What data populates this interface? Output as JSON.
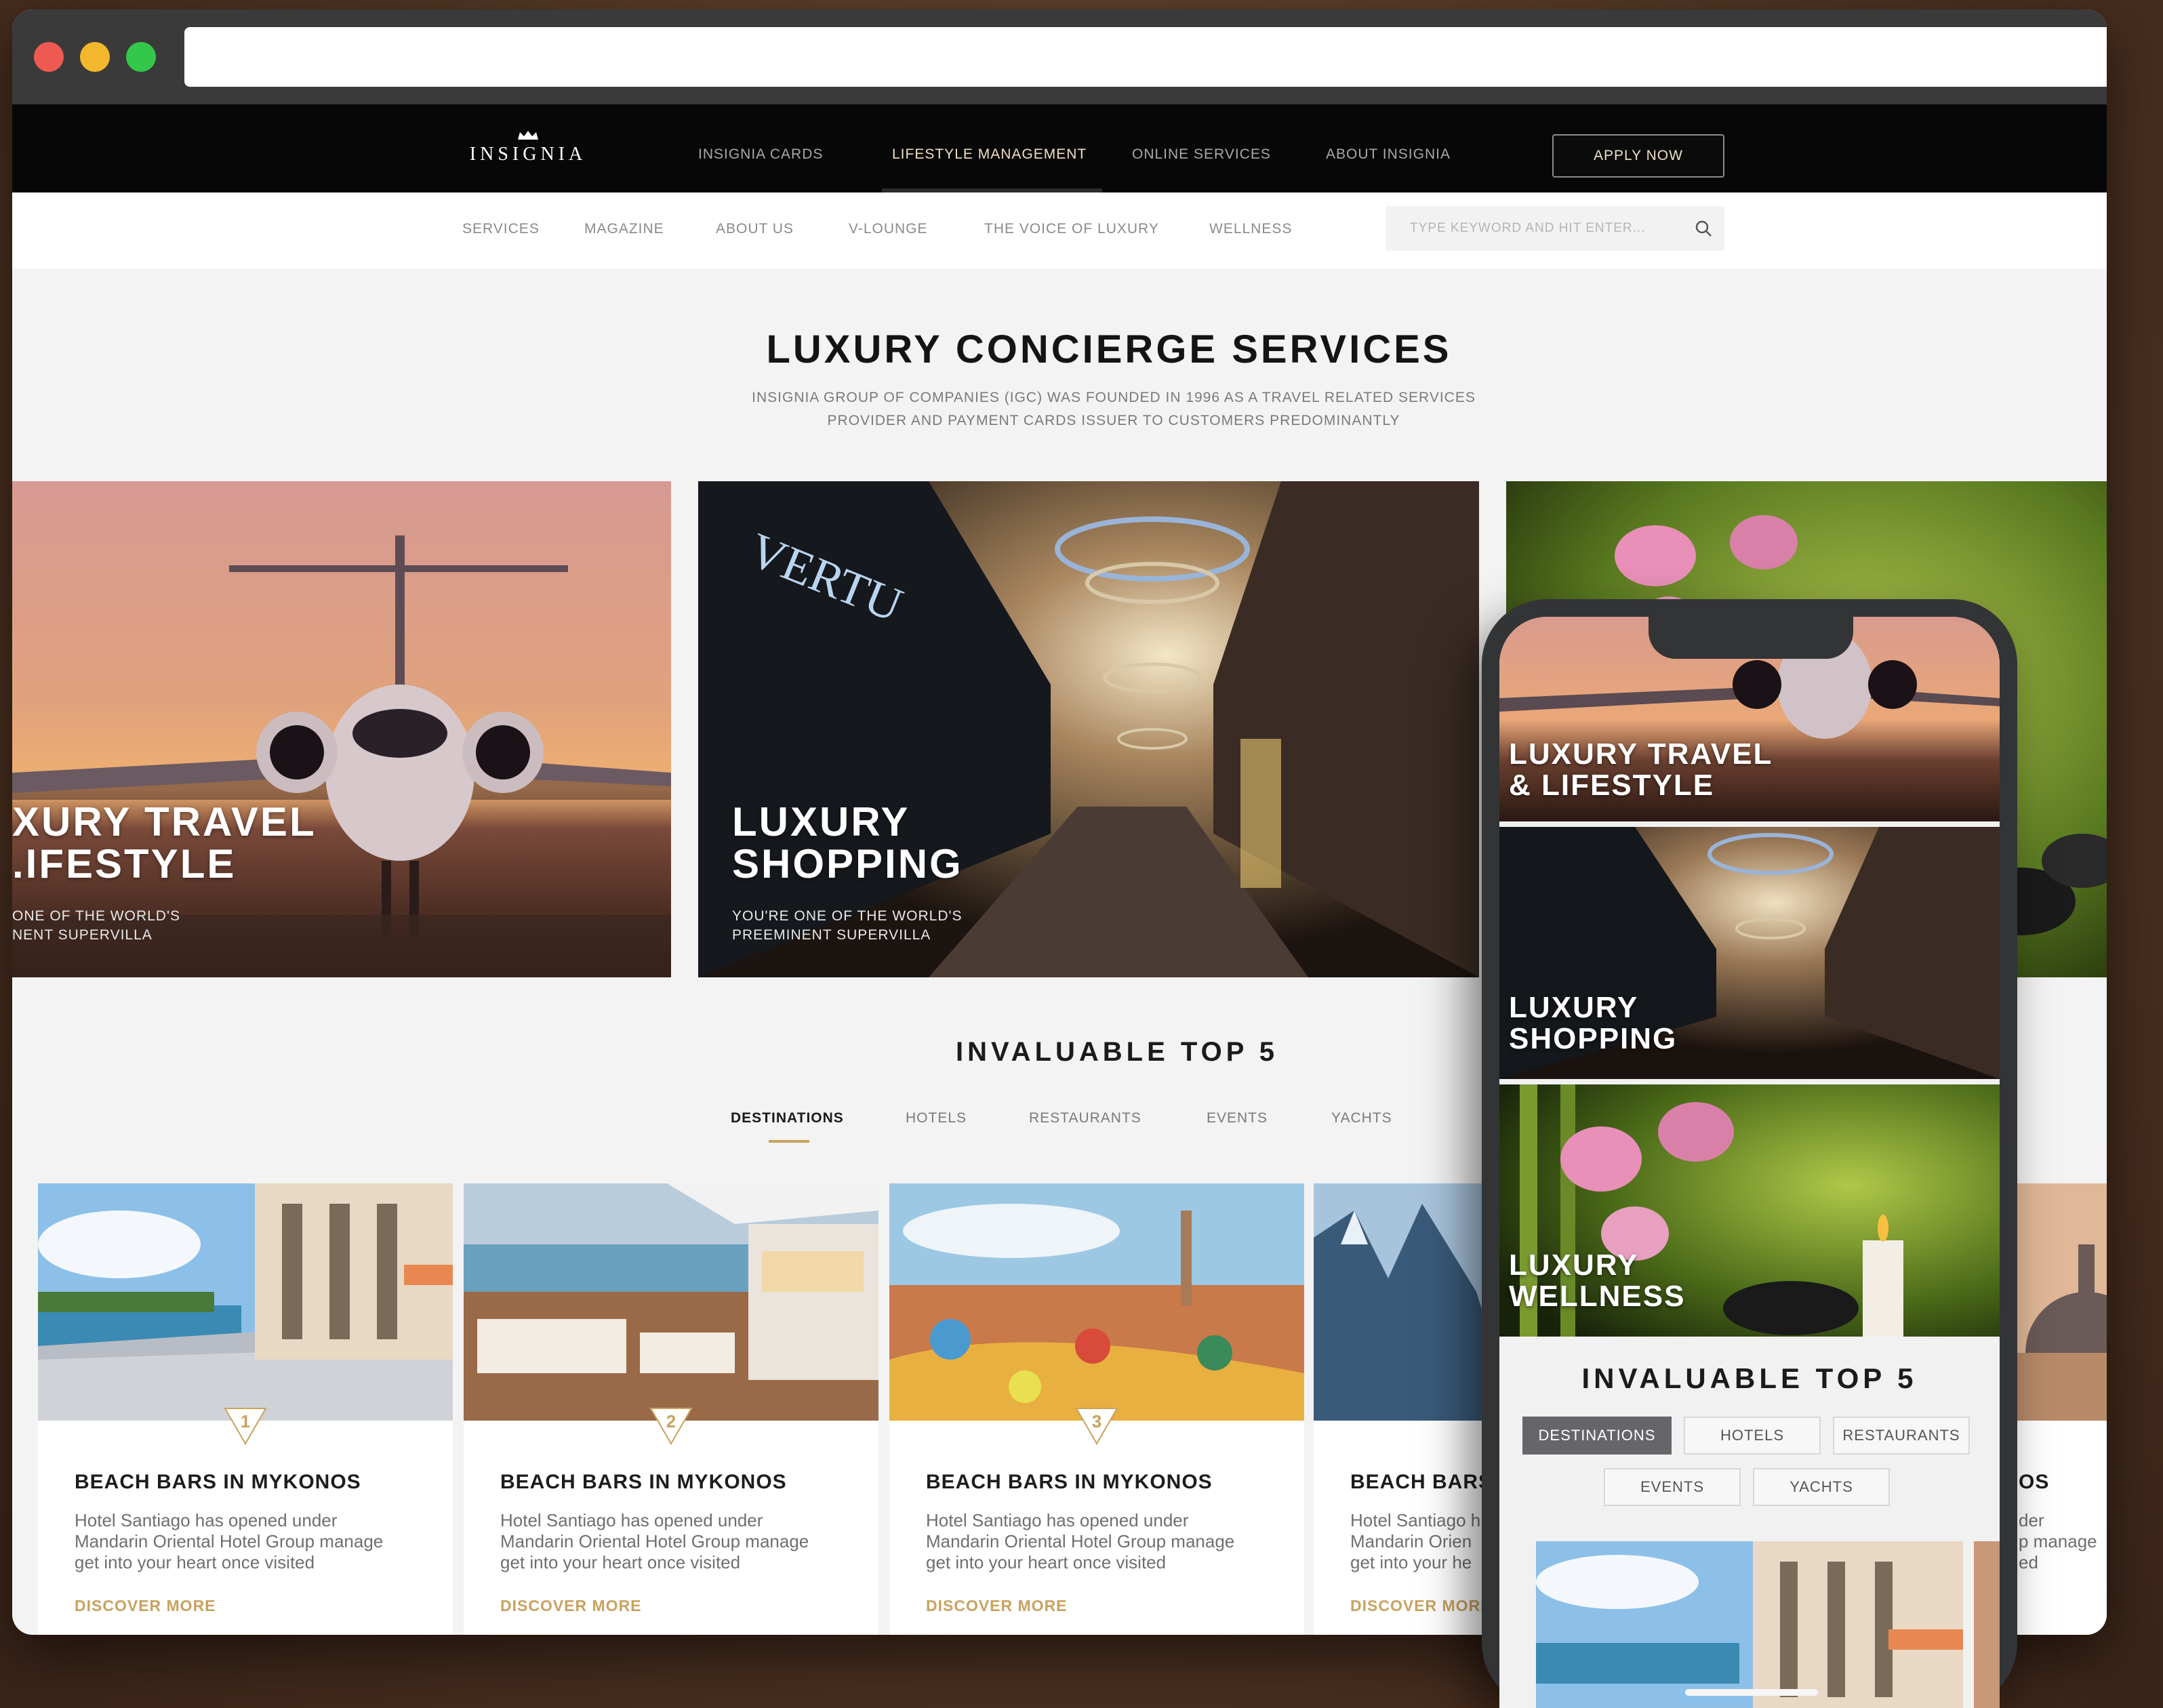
{
  "top_nav": {
    "logo": "INSIGNIA",
    "items": [
      "INSIGNIA CARDS",
      "LIFESTYLE MANAGEMENT",
      "ONLINE SERVICES",
      "ABOUT INSIGNIA"
    ],
    "active_item": "LIFESTYLE MANAGEMENT",
    "apply_label": "APPLY NOW"
  },
  "sub_nav": {
    "items": [
      "SERVICES",
      "MAGAZINE",
      "ABOUT US",
      "V-LOUNGE",
      "THE VOICE OF LUXURY",
      "WELLNESS"
    ],
    "search_placeholder": "TYPE KEYWORD AND HIT ENTER..."
  },
  "hero": {
    "title": "LUXURY CONCIERGE SERVICES",
    "description": "INSIGNIA GROUP OF COMPANIES (IGC) WAS FOUNDED IN 1996 AS A TRAVEL RELATED SERVICES PROVIDER AND PAYMENT CARDS ISSUER TO CUSTOMERS PREDOMINANTLY"
  },
  "services": [
    {
      "title": "XURY TRAVEL\n.IFESTYLE",
      "subtitle": "ONE OF THE WORLD'S\nNENT SUPERVILLA"
    },
    {
      "title": "LUXURY\nSHOPPING",
      "subtitle": "YOU'RE ONE OF THE WORLD'S\nPREEMINENT SUPERVILLA"
    },
    {
      "title": "",
      "subtitle": ""
    }
  ],
  "top5": {
    "title": "INVALUABLE TOP 5",
    "tabs": [
      "DESTINATIONS",
      "HOTELS",
      "RESTAURANTS",
      "EVENTS",
      "YACHTS"
    ],
    "active_tab": "DESTINATIONS",
    "cards": [
      {
        "rank": "1",
        "title": "BEACH BARS IN MYKONOS",
        "text": "Hotel Santiago has opened under\nMandarin Oriental Hotel Group manage\nget into your heart once visited",
        "link": "DISCOVER MORE"
      },
      {
        "rank": "2",
        "title": "BEACH BARS IN MYKONOS",
        "text": "Hotel Santiago has opened under\nMandarin Oriental Hotel Group manage\nget into your heart once visited",
        "link": "DISCOVER MORE"
      },
      {
        "rank": "3",
        "title": "BEACH BARS IN MYKONOS",
        "text": "Hotel Santiago has opened under\nMandarin Oriental Hotel Group manage\nget into your heart once visited",
        "link": "DISCOVER MORE"
      },
      {
        "rank": "",
        "title": "BEACH BARS",
        "text": "Hotel Santiago h\nMandarin Orien\nget into your he",
        "link": "DISCOVER MORE"
      },
      {
        "rank": "",
        "title": "OS",
        "text": "der\np manage\ned",
        "link": ""
      }
    ]
  },
  "phone": {
    "cards": [
      "LUXURY TRAVEL\n& LIFESTYLE",
      "LUXURY\nSHOPPING",
      "LUXURY\nWELLNESS"
    ],
    "top5_title": "INVALUABLE TOP 5",
    "tabs": [
      "DESTINATIONS",
      "HOTELS",
      "RESTAURANTS",
      "EVENTS",
      "YACHTS"
    ],
    "active_tab": "DESTINATIONS"
  },
  "colors": {
    "accent_gold": "#c9a25f",
    "nav_black": "#070707",
    "page_bg": "#f3f3f3"
  }
}
